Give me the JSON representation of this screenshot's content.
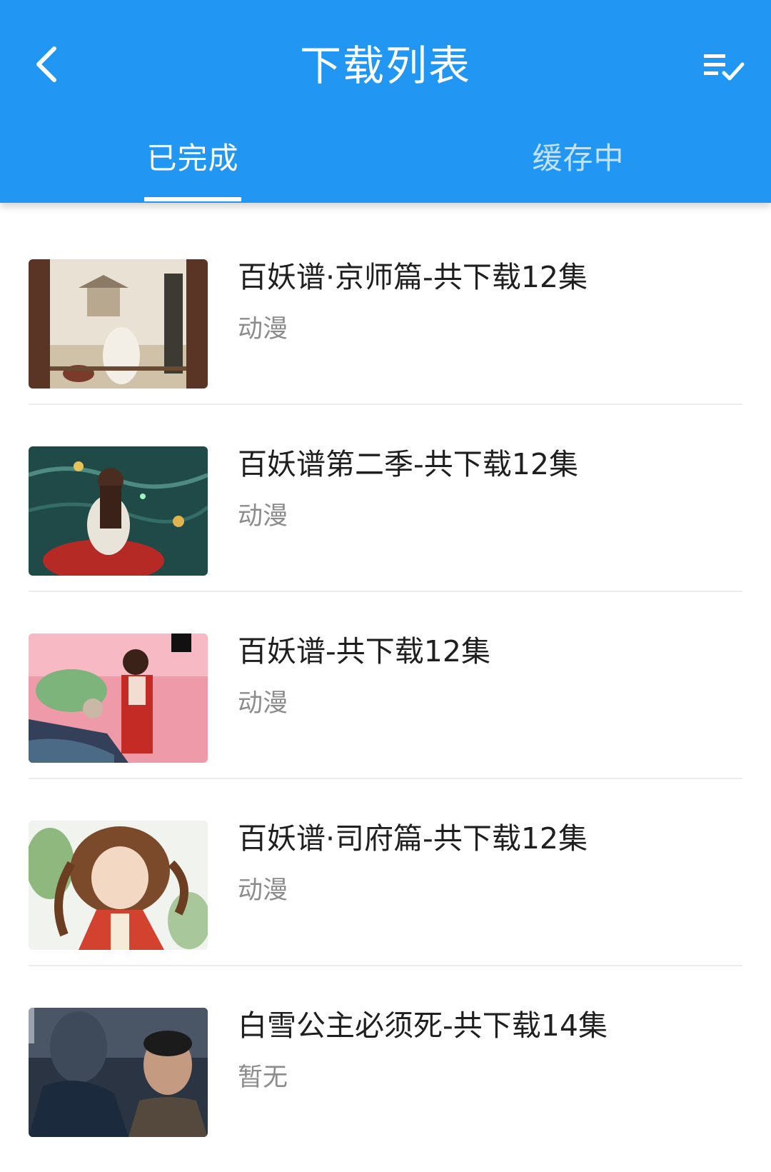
{
  "header": {
    "title": "下载列表",
    "back_icon": "chevron-left-icon",
    "select_icon": "list-check-icon"
  },
  "tabs": [
    {
      "label": "已完成",
      "active": true
    },
    {
      "label": "缓存中",
      "active": false
    }
  ],
  "colors": {
    "primary": "#2196f3",
    "text_primary": "#1f1f1f",
    "text_secondary": "#8c8c8c"
  },
  "downloads": [
    {
      "title": "百妖谱·京师篇-共下载12集",
      "category": "动漫"
    },
    {
      "title": "百妖谱第二季-共下载12集",
      "category": "动漫"
    },
    {
      "title": "百妖谱-共下载12集",
      "category": "动漫"
    },
    {
      "title": "百妖谱·司府篇-共下载12集",
      "category": "动漫"
    },
    {
      "title": "白雪公主必须死-共下载14集",
      "category": "暂无"
    }
  ]
}
